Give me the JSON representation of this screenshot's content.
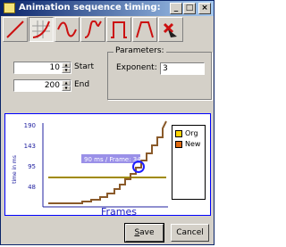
{
  "window": {
    "title": "Animation sequence timing:",
    "icon": "window-icon"
  },
  "caption_buttons": {
    "minimize": "_",
    "maximize": "□",
    "close": "×"
  },
  "toolbar": {
    "buttons": [
      {
        "icon": "linear-curve-icon"
      },
      {
        "icon": "exponential-curve-icon",
        "active": true
      },
      {
        "icon": "sine-wave-icon"
      },
      {
        "icon": "ease-in-out-curve-icon"
      },
      {
        "icon": "step-curve-icon"
      },
      {
        "icon": "pulse-curve-icon"
      },
      {
        "icon": "reset-marker-icon"
      }
    ]
  },
  "start": {
    "value": "10",
    "label": "Start"
  },
  "end": {
    "value": "200",
    "label": "End"
  },
  "parameters": {
    "title": "Parameters:",
    "exponent_label": "Exponent:",
    "exponent_value": "3"
  },
  "graph": {
    "y_axis_label": "time in ms",
    "x_axis_label": "Frames",
    "y_ticks": [
      "190",
      "143",
      "95",
      "48"
    ],
    "annotation": "90 ms / Frame: 34",
    "legend": [
      {
        "label": "Org",
        "color": "#ffd400"
      },
      {
        "label": "New",
        "color": "#e06a10"
      }
    ],
    "colors": {
      "org_line": "#a08a00",
      "new_line": "#8a5a2a",
      "marker": "#2020ff",
      "axis": "#2020a0"
    }
  },
  "buttons": {
    "save": {
      "mnemonic": "S",
      "rest": "ave"
    },
    "cancel": {
      "label": "Cancel"
    }
  }
}
